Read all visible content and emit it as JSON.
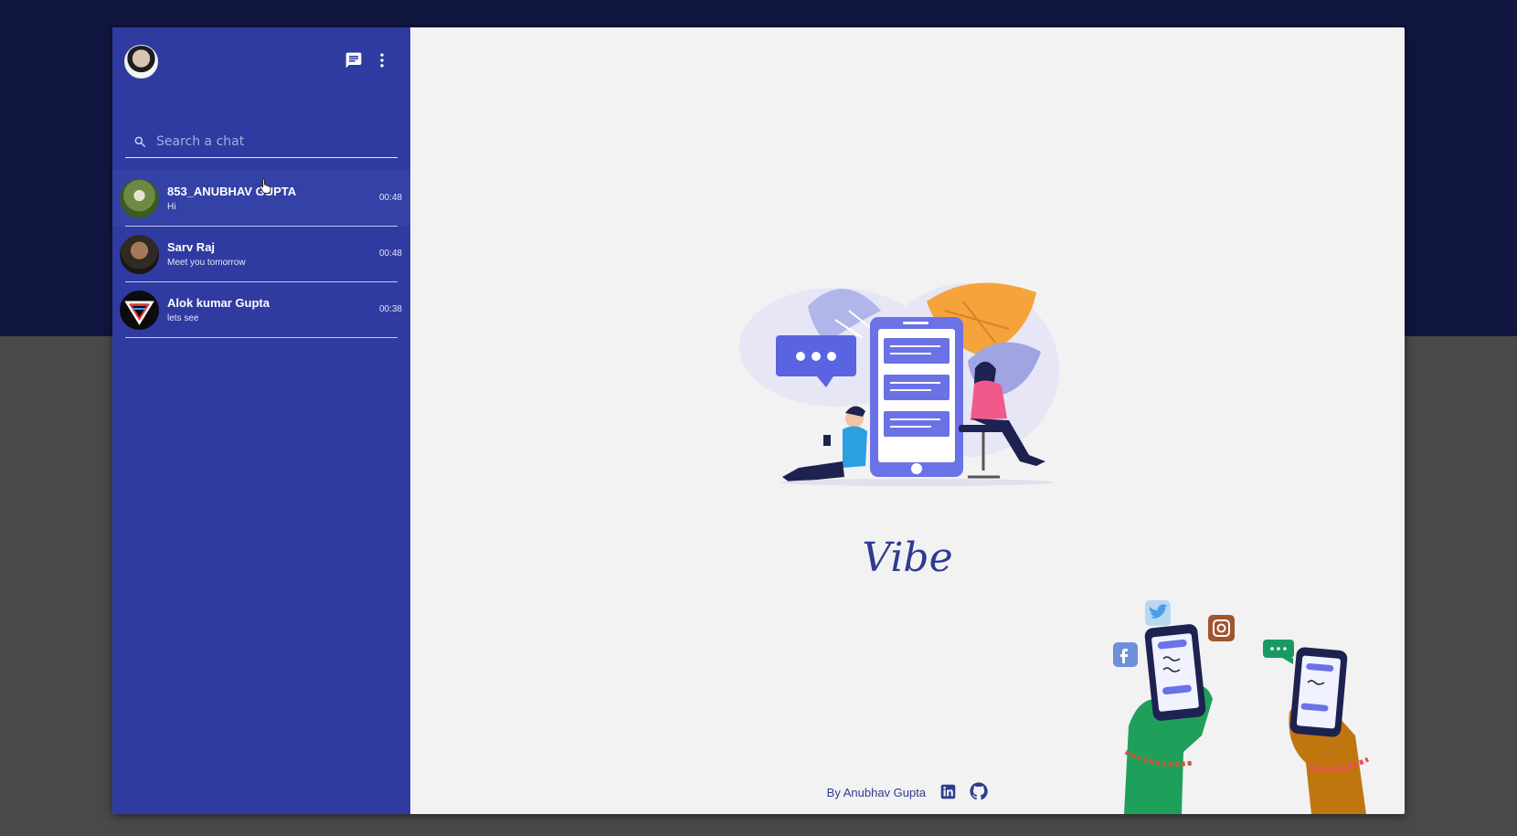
{
  "search": {
    "placeholder": "Search a chat"
  },
  "chats": [
    {
      "name": "853_ANUBHAV GUPTA",
      "last_message": "Hi",
      "time": "00:48"
    },
    {
      "name": "Sarv Raj",
      "last_message": "Meet you tomorrow",
      "time": "00:48"
    },
    {
      "name": "Alok kumar Gupta",
      "last_message": "lets see",
      "time": "00:38"
    }
  ],
  "main": {
    "brand": "Vibe",
    "footer_credit": "By Anubhav Gupta"
  },
  "colors": {
    "sidebar": "#2f3ba1",
    "page_top": "#10163f",
    "page_bottom": "#494949",
    "main_bg": "#f2f2f2",
    "accent": "#2f3a91"
  },
  "icons": [
    "chat-icon",
    "more-vert-icon",
    "search-icon",
    "linkedin-icon",
    "github-icon",
    "twitter-icon",
    "instagram-icon",
    "facebook-icon"
  ]
}
